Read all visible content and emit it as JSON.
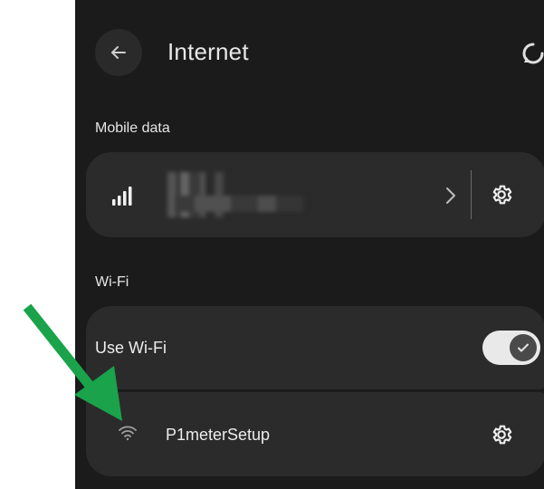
{
  "header": {
    "title": "Internet"
  },
  "sections": {
    "mobile_label": "Mobile data",
    "wifi_label": "Wi-Fi"
  },
  "wifi": {
    "toggle_label": "Use Wi-Fi",
    "toggle_on": true
  },
  "networks": [
    {
      "name": "P1meterSetup"
    }
  ],
  "colors": {
    "background": "#1b1b1b",
    "card": "#2b2b2b",
    "text": "#ececec",
    "arrow": "#1aa34a"
  },
  "icons": [
    "back-arrow-icon",
    "refresh-icon",
    "signal-bars-icon",
    "chevron-right-icon",
    "gear-icon",
    "check-icon",
    "wifi-icon"
  ]
}
